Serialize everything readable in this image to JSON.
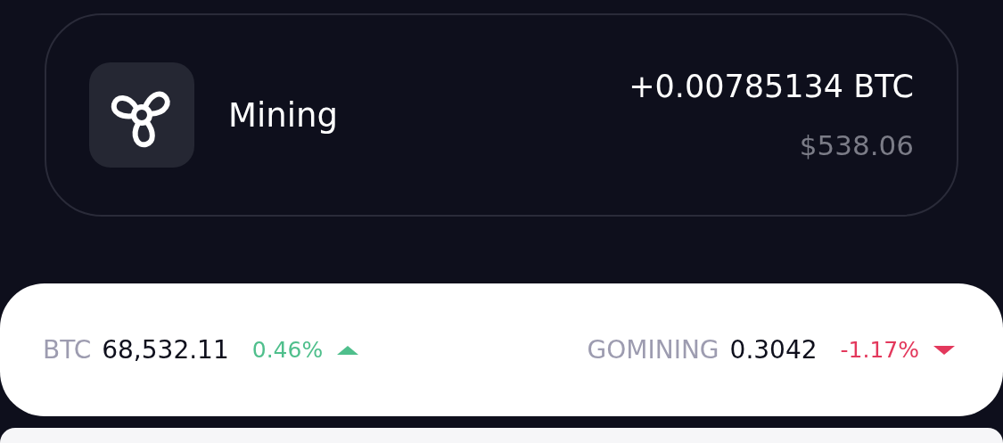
{
  "mining_card": {
    "title": "Mining",
    "amount": "+0.00785134 BTC",
    "fiat": "$538.06"
  },
  "tickers": [
    {
      "symbol": "BTC",
      "price": "68,532.11",
      "change": "0.46%",
      "rising": true
    },
    {
      "symbol": "GOMINING",
      "price": "0.3042",
      "change": "-1.17%",
      "rising": false
    }
  ]
}
